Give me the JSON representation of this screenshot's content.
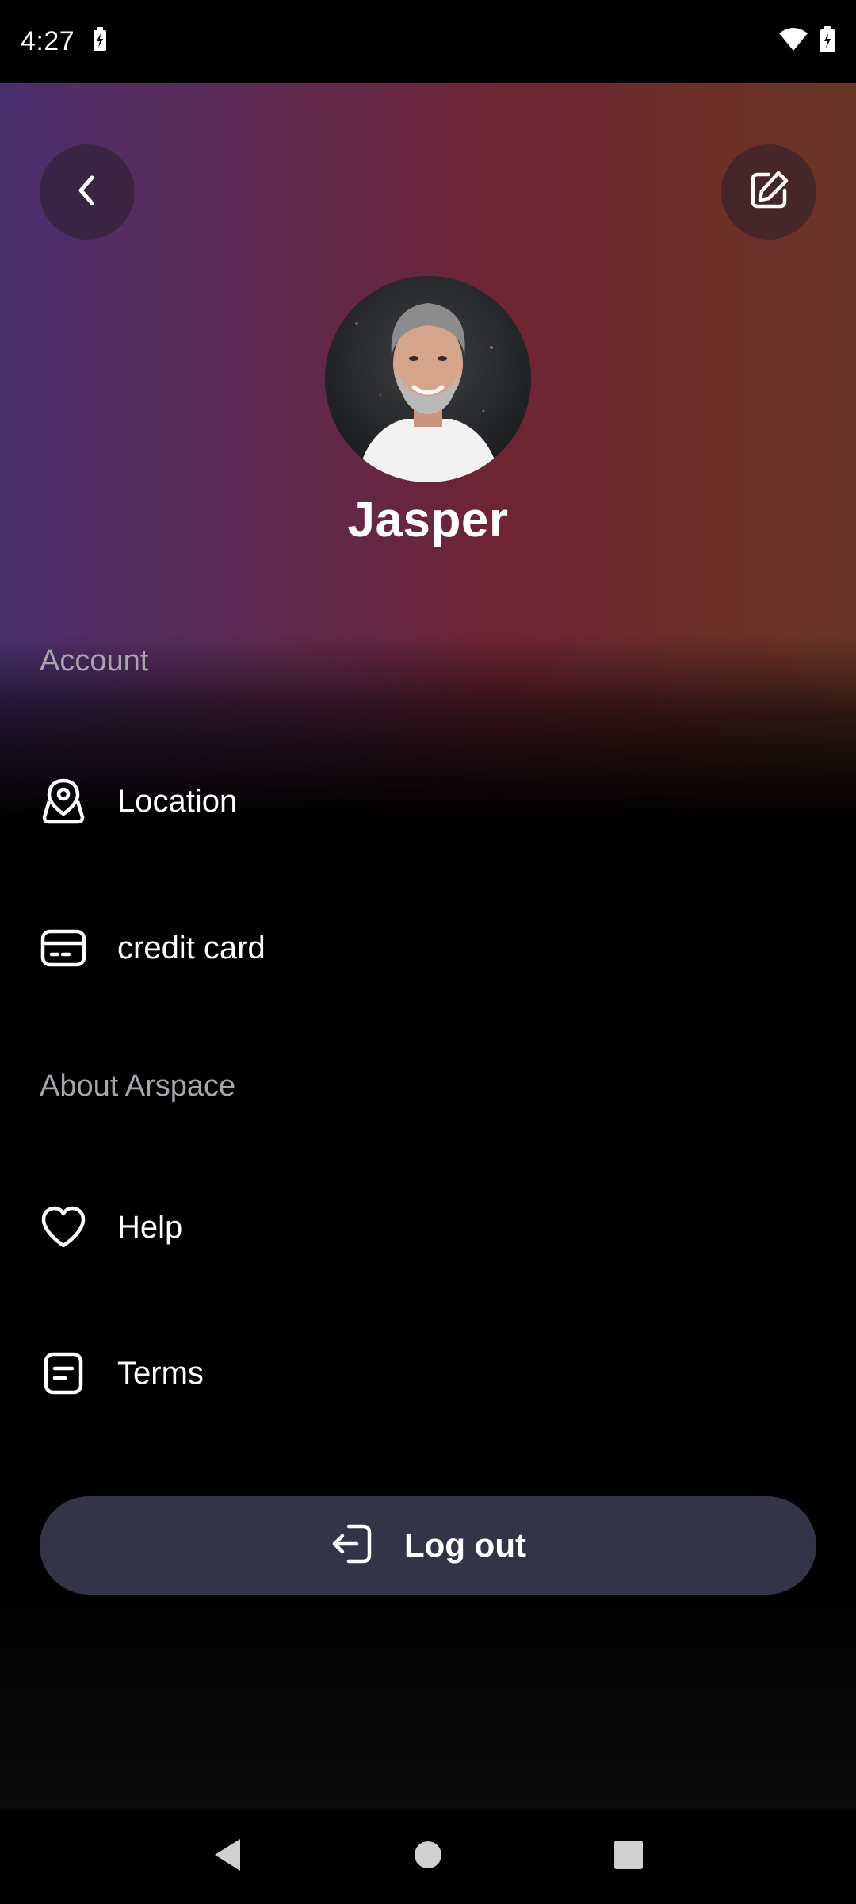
{
  "status_bar": {
    "time": "4:27"
  },
  "profile": {
    "name": "Jasper"
  },
  "sections": {
    "account": "Account",
    "about": "About Arspace"
  },
  "menu": {
    "location": "Location",
    "credit_card": "credit card",
    "help": "Help",
    "terms": "Terms"
  },
  "logout": {
    "label": "Log out"
  },
  "icons": {
    "back": "chevron-left-icon",
    "edit": "edit-icon",
    "location": "location-icon",
    "card": "credit-card-icon",
    "help": "heart-icon",
    "terms": "document-icon",
    "logout": "logout-icon"
  },
  "colors": {
    "gradient_start": "#4a2f6e",
    "gradient_mid": "#6e2434",
    "gradient_end": "#6b3526",
    "logout_bg": "#343449",
    "section_text": "#a9a3ad"
  }
}
